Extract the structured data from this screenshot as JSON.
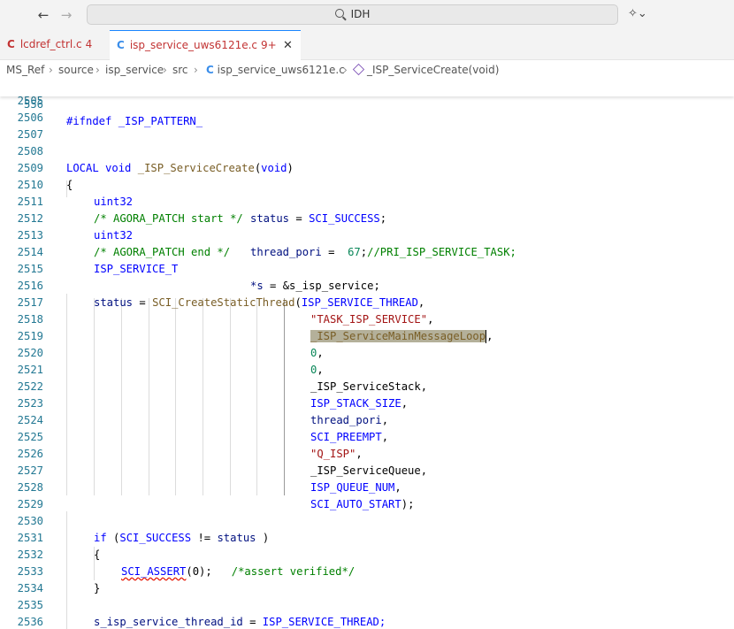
{
  "titlebar": {
    "search_text": "IDH"
  },
  "tabs": [
    {
      "icon": "C",
      "name": "lcdref_ctrl.c",
      "count": "4"
    },
    {
      "icon": "C",
      "name": "isp_service_uws6121e.c",
      "count": "9+",
      "close": "✕"
    }
  ],
  "breadcrumb": {
    "items": [
      "MS_Ref",
      "source",
      "isp_service",
      "src",
      "isp_service_uws6121e.c",
      "_ISP_ServiceCreate(void)"
    ],
    "file_icon": "C"
  },
  "editor": {
    "sticky": {
      "line": "556",
      "text": "#ifndef _ISP_PATTERN_"
    },
    "lines": [
      {
        "n": "2505"
      },
      {
        "n": "2506"
      },
      {
        "n": "2507"
      },
      {
        "n": "2508"
      },
      {
        "n": "2509"
      },
      {
        "n": "2510"
      },
      {
        "n": "2511"
      },
      {
        "n": "2512"
      },
      {
        "n": "2513"
      },
      {
        "n": "2514"
      },
      {
        "n": "2515"
      },
      {
        "n": "2516"
      },
      {
        "n": "2517"
      },
      {
        "n": "2518"
      },
      {
        "n": "2519"
      },
      {
        "n": "2520"
      },
      {
        "n": "2521"
      },
      {
        "n": "2522"
      },
      {
        "n": "2523"
      },
      {
        "n": "2524"
      },
      {
        "n": "2525"
      },
      {
        "n": "2526"
      },
      {
        "n": "2527"
      },
      {
        "n": "2528"
      },
      {
        "n": "2529"
      },
      {
        "n": "2530"
      },
      {
        "n": "2531"
      },
      {
        "n": "2532"
      },
      {
        "n": "2533"
      },
      {
        "n": "2534"
      },
      {
        "n": "2535"
      },
      {
        "n": "2536"
      }
    ],
    "code": {
      "l2508": [
        "LOCAL",
        "void",
        "_ISP_ServiceCreate",
        "(",
        "void",
        ")"
      ],
      "l2509": "{",
      "l2510": [
        "uint32",
        "status",
        "=",
        "SCI_SUCCESS",
        ";"
      ],
      "l2511": "/* AGORA_PATCH start */",
      "l2512": [
        "uint32",
        "thread_pori",
        "=",
        "67",
        ";",
        "//PRI_ISP_SERVICE_TASK;"
      ],
      "l2513": "/* AGORA_PATCH end */",
      "l2514": [
        "ISP_SERVICE_T",
        "*s",
        "=",
        "&s_isp_service;"
      ],
      "l2516": [
        "status",
        "=",
        "SCI_CreateStaticThread",
        "(",
        "ISP_SERVICE_THREAD",
        ","
      ],
      "l2517": [
        "\"TASK_ISP_SERVICE\"",
        ","
      ],
      "l2518": [
        "_ISP_ServiceMainMessageLoop",
        ","
      ],
      "l2519": [
        "0",
        ","
      ],
      "l2520": [
        "0",
        ","
      ],
      "l2521": [
        "_ISP_ServiceStack",
        ","
      ],
      "l2522": [
        "ISP_STACK_SIZE",
        ","
      ],
      "l2523": [
        "thread_pori",
        ","
      ],
      "l2524": [
        "SCI_PREEMPT",
        ","
      ],
      "l2525": [
        "\"Q_ISP\"",
        ","
      ],
      "l2526": [
        "_ISP_ServiceQueue",
        ","
      ],
      "l2527": [
        "ISP_QUEUE_NUM",
        ","
      ],
      "l2528": [
        "SCI_AUTO_START",
        ");"
      ],
      "l2530": [
        "if",
        "(",
        "SCI_SUCCESS",
        "!=",
        "status",
        ")"
      ],
      "l2531": "{",
      "l2532": [
        "SCI_ASSERT",
        "(0);",
        "/*assert verified*/"
      ],
      "l2533": "}",
      "l2535": [
        "s_isp_service_thread_id",
        "=",
        "ISP_SERVICE_THREAD;"
      ]
    }
  },
  "colors": {
    "keyword": "#0000ff",
    "type": "#267f99",
    "function": "#795e26",
    "string": "#a31515",
    "number": "#098658",
    "comment": "#008000",
    "line_number": "#237893",
    "tab_accent": "#1a85ff"
  },
  "icons": [
    "back-arrow-icon",
    "forward-arrow-icon",
    "search-icon",
    "copilot-icon",
    "close-icon",
    "c-file-icon",
    "method-cube-icon"
  ]
}
